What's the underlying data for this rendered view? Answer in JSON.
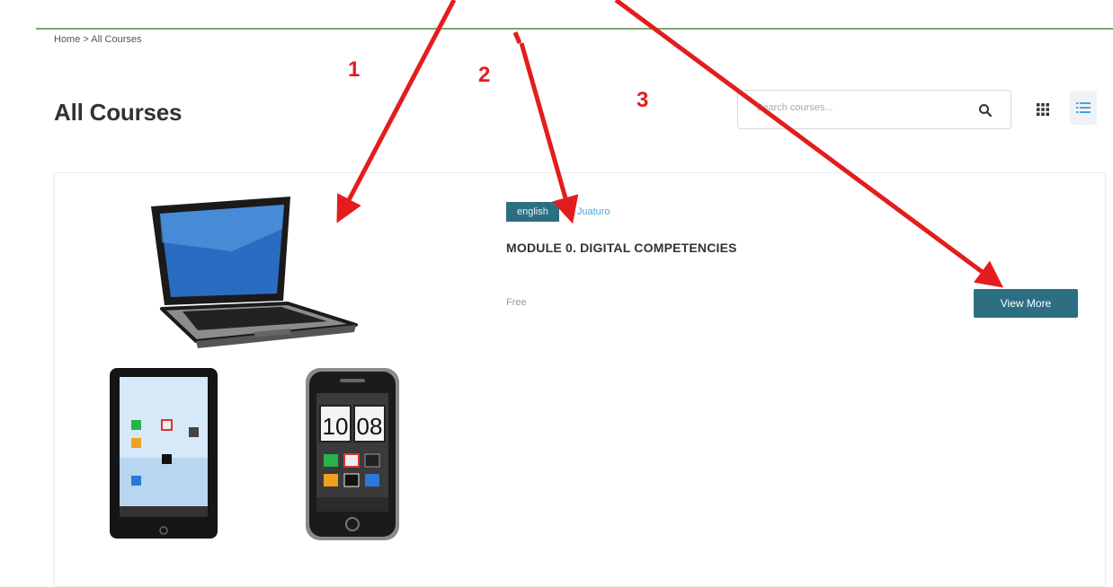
{
  "breadcrumb": "Home > All Courses",
  "page": {
    "title": "All Courses"
  },
  "search": {
    "placeholder": "Search courses...",
    "icon": "search-icon"
  },
  "view_toggle": {
    "grid_icon": "grid-view-icon",
    "list_icon": "list-view-icon",
    "active": "list"
  },
  "course": {
    "language_tag": "english",
    "author": "Juaturo",
    "title": "MODULE 0. DIGITAL COMPETENCIES",
    "price": "Free",
    "button_label": "View More",
    "thumbnail": "laptop-tablet-phone-illustration",
    "phone_clock": {
      "hours": "10",
      "minutes": "08"
    }
  },
  "annotations": [
    {
      "label": "1"
    },
    {
      "label": "2"
    },
    {
      "label": "3"
    }
  ],
  "colors": {
    "accent": "#2d6f82",
    "author_link": "#4aa3df",
    "annotation": "#e31d1d",
    "top_rule": "#7fa66f"
  }
}
